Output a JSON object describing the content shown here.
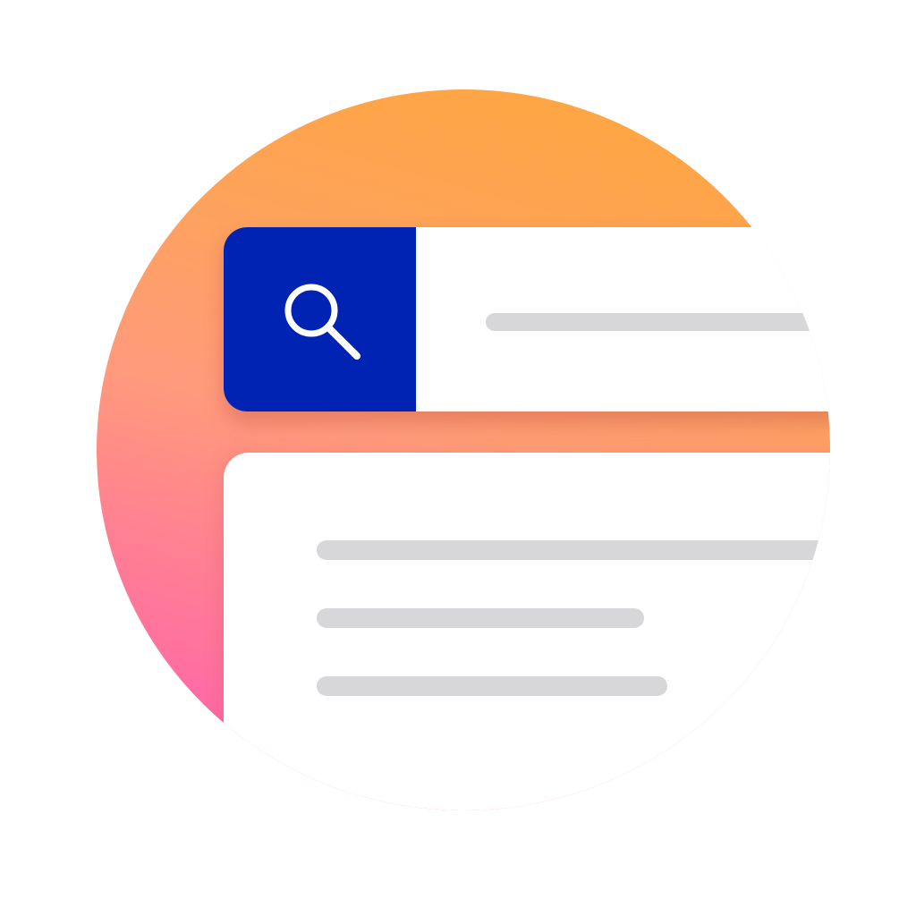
{
  "search": {
    "icon": "search-icon",
    "button_color": "#0023b4",
    "placeholder": ""
  },
  "results": {
    "line_count": 3
  },
  "colors": {
    "gradient_top": "#ffa73a",
    "gradient_bottom": "#ff58b4",
    "card": "#ffffff",
    "placeholder_bar": "#d7d7da"
  }
}
